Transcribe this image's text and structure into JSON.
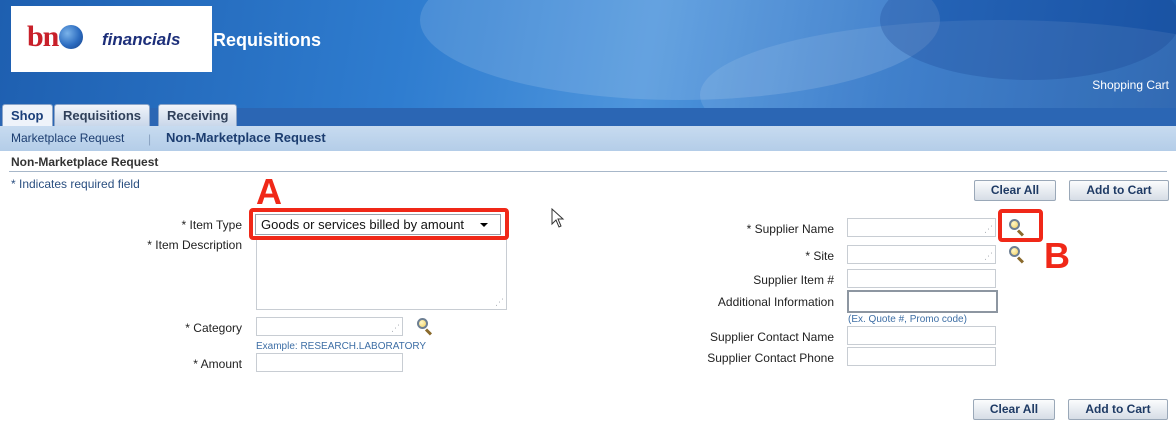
{
  "header": {
    "logo_mark": "bn",
    "logo_text": "financials",
    "title": "Requisitions",
    "shopping_cart": "Shopping Cart"
  },
  "tabs": [
    {
      "label": "Shop",
      "active": true
    },
    {
      "label": "Requisitions",
      "active": false
    },
    {
      "label": "Receiving",
      "active": false
    }
  ],
  "subnav": {
    "items": [
      "Marketplace Request",
      "Non-Marketplace Request"
    ],
    "separator": "|",
    "active": "Non-Marketplace Request"
  },
  "page": {
    "section_title": "Non-Marketplace Request",
    "required_note": "* Indicates required field",
    "clear_all": "Clear All",
    "add_to_cart": "Add to Cart"
  },
  "left_form": {
    "item_type": {
      "label": "* Item Type",
      "value": "Goods or services billed by amount"
    },
    "item_description": {
      "label": "* Item Description",
      "value": ""
    },
    "category": {
      "label": "* Category",
      "value": "",
      "hint": "Example: RESEARCH.LABORATORY"
    },
    "amount": {
      "label": "* Amount",
      "value": ""
    }
  },
  "right_form": {
    "supplier_name": {
      "label": "* Supplier Name",
      "value": ""
    },
    "site": {
      "label": "* Site",
      "value": ""
    },
    "supplier_item": {
      "label": "Supplier Item #",
      "value": ""
    },
    "additional_info": {
      "label": "Additional Information",
      "value": "",
      "hint": "(Ex. Quote #, Promo code)"
    },
    "contact_name": {
      "label": "Supplier Contact Name",
      "value": ""
    },
    "contact_phone": {
      "label": "Supplier Contact Phone",
      "value": ""
    }
  },
  "annotations": {
    "a": "A",
    "b": "B",
    "color": "#f02818"
  },
  "colors": {
    "header_blue": "#2b66b4",
    "subnav_blue": "#b4cde8",
    "label_blue": "#1c3d70"
  }
}
